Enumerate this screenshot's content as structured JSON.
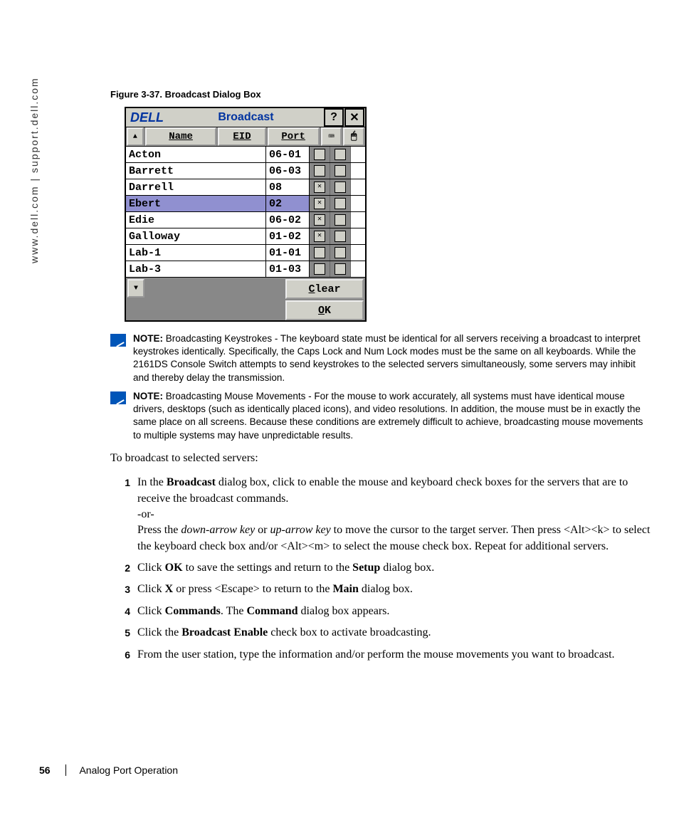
{
  "sidebar": "www.dell.com | support.dell.com",
  "figure_caption": "Figure 3-37.    Broadcast Dialog Box",
  "dialog": {
    "logo": "DELL",
    "title": "Broadcast",
    "help_btn": "?",
    "close_btn": "✕",
    "sort_up": "▲",
    "headers": {
      "name": "Name",
      "eid": "EID",
      "port": "Port",
      "kbd_icon": "⌨",
      "mouse_icon": "🖱"
    },
    "rows": [
      {
        "name": "Acton",
        "port": "06-01",
        "kbd": false,
        "mouse": false,
        "selected": false
      },
      {
        "name": "Barrett",
        "port": "06-03",
        "kbd": false,
        "mouse": false,
        "selected": false
      },
      {
        "name": "Darrell",
        "port": "08",
        "kbd": true,
        "mouse": false,
        "selected": false
      },
      {
        "name": "Ebert",
        "port": "02",
        "kbd": true,
        "mouse": false,
        "selected": true
      },
      {
        "name": "Edie",
        "port": "06-02",
        "kbd": true,
        "mouse": false,
        "selected": false
      },
      {
        "name": "Galloway",
        "port": "01-02",
        "kbd": true,
        "mouse": false,
        "selected": false
      },
      {
        "name": "Lab-1",
        "port": "01-01",
        "kbd": false,
        "mouse": false,
        "selected": false
      },
      {
        "name": "Lab-3",
        "port": "01-03",
        "kbd": false,
        "mouse": false,
        "selected": false
      }
    ],
    "scroll_dn": "▼",
    "clear_btn": {
      "u": "C",
      "rest": "lear"
    },
    "ok_btn": {
      "u": "O",
      "rest": "K"
    }
  },
  "notes": [
    {
      "header": "NOTE:",
      "bold": "Broadcasting Keystrokes",
      "text": " - The keyboard state must be identical for all servers receiving a broadcast to interpret keystrokes identically. Specifically, the Caps Lock and Num Lock modes must be the same on all keyboards. While the 2161DS Console Switch attempts to send keystrokes to the selected servers simultaneously, some servers may inhibit and thereby delay the transmission."
    },
    {
      "header": "NOTE:",
      "bold": "Broadcasting Mouse Movements",
      "text": " - For the mouse to work accurately, all systems must have identical mouse drivers, desktops (such as identically placed icons), and video resolutions. In addition, the mouse must be in exactly the same place on all screens. Because these conditions are extremely difficult to achieve, broadcasting mouse movements to multiple systems may have unpredictable results."
    }
  ],
  "intro": "To broadcast to selected servers:",
  "steps": [
    {
      "num": "1",
      "parts": [
        {
          "t": "In the "
        },
        {
          "b": "Broadcast"
        },
        {
          "t": " dialog box, click to enable the mouse and keyboard check boxes for the servers that are to receive the broadcast commands."
        },
        {
          "br": 1
        },
        {
          "t": "-or-"
        },
        {
          "br": 1
        },
        {
          "t": "Press the "
        },
        {
          "i": "down-arrow key"
        },
        {
          "t": " or "
        },
        {
          "i": "up-arrow key"
        },
        {
          "t": " to move the cursor to the target server. Then press <Alt><k> to select the keyboard check box and/or <Alt><m> to select the mouse check box. Repeat for additional servers."
        }
      ]
    },
    {
      "num": "2",
      "parts": [
        {
          "t": "Click "
        },
        {
          "b": "OK"
        },
        {
          "t": " to save the settings and return to the "
        },
        {
          "b": "Setup"
        },
        {
          "t": " dialog box."
        }
      ]
    },
    {
      "num": "3",
      "parts": [
        {
          "t": "Click "
        },
        {
          "b": "X"
        },
        {
          "t": " or press <Escape> to return to the "
        },
        {
          "b": "Main"
        },
        {
          "t": " dialog box."
        }
      ]
    },
    {
      "num": "4",
      "parts": [
        {
          "t": "Click "
        },
        {
          "b": "Commands"
        },
        {
          "t": ". The "
        },
        {
          "b": "Command"
        },
        {
          "t": " dialog box appears."
        }
      ]
    },
    {
      "num": "5",
      "parts": [
        {
          "t": "Click the "
        },
        {
          "b": "Broadcast Enable"
        },
        {
          "t": " check box to activate broadcasting."
        }
      ]
    },
    {
      "num": "6",
      "parts": [
        {
          "t": "From the user station, type the information and/or perform the mouse movements you want to broadcast."
        }
      ]
    }
  ],
  "footer": {
    "page": "56",
    "section": "Analog Port Operation"
  }
}
